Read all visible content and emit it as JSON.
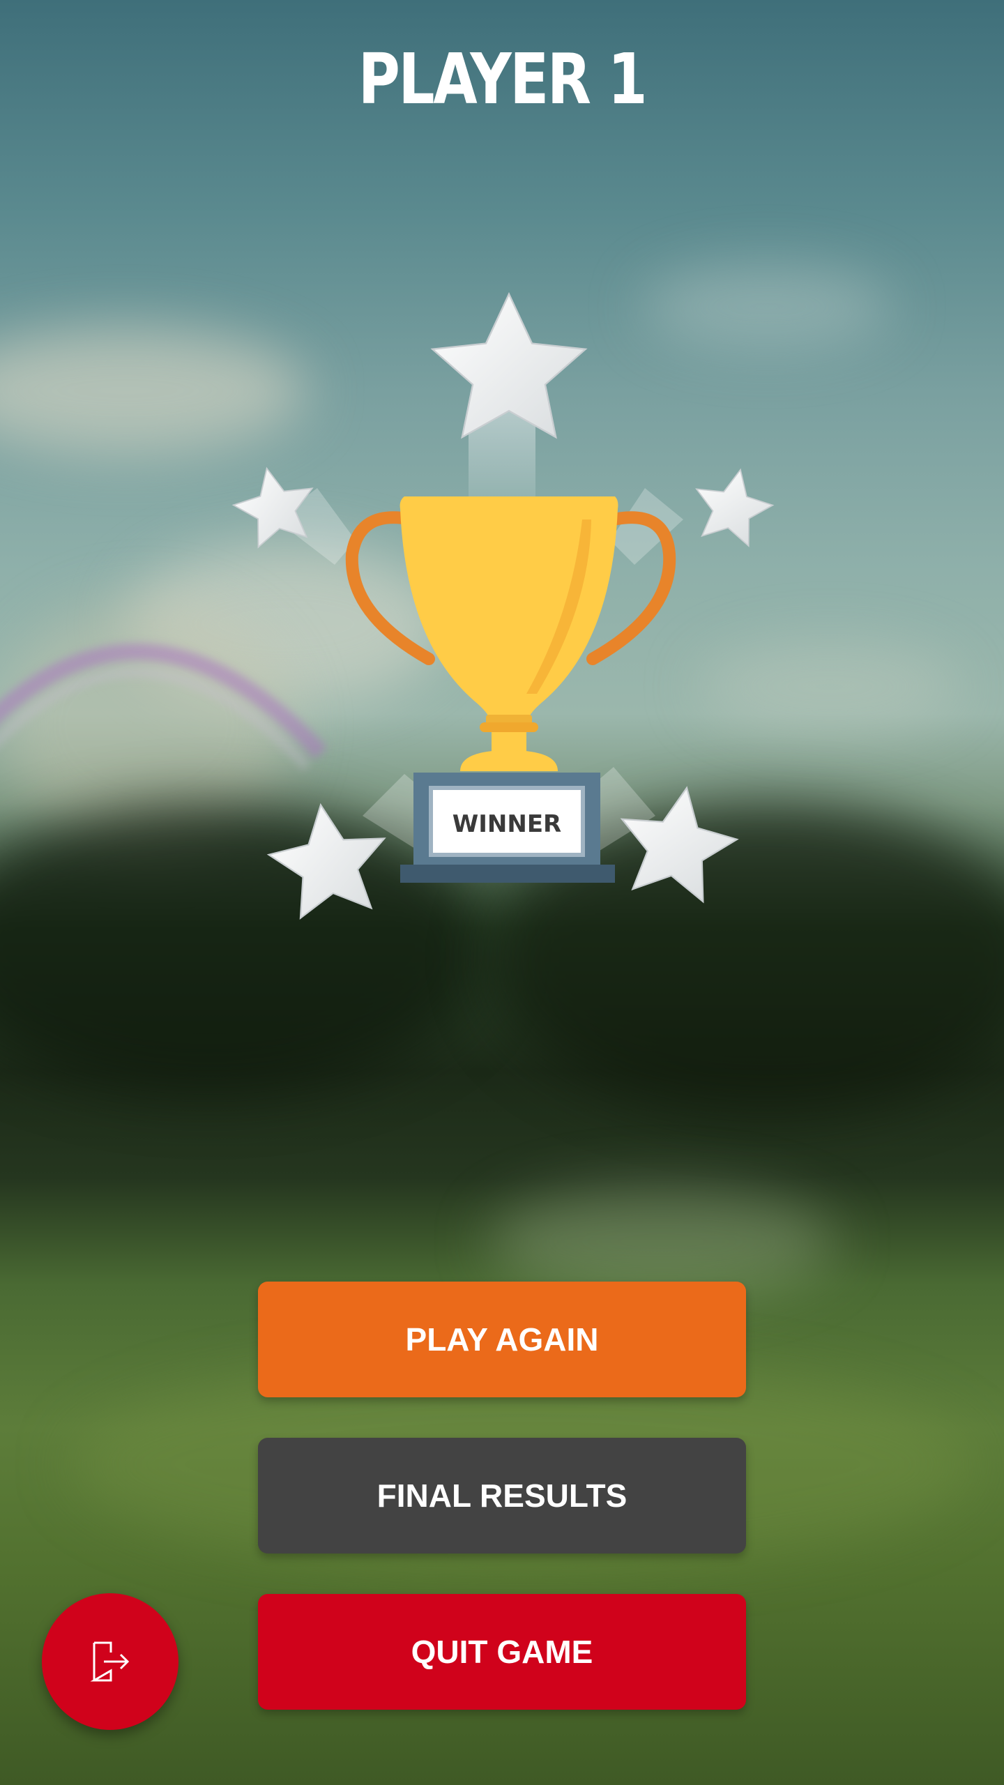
{
  "header": {
    "title": "PLAYER 1"
  },
  "trophy": {
    "plaque_text": "WINNER",
    "icon": "trophy-icon",
    "star_icon": "star-icon"
  },
  "actions": {
    "play_again_label": "PLAY AGAIN",
    "final_results_label": "FINAL RESULTS",
    "quit_game_label": "QUIT GAME"
  },
  "fab": {
    "icon": "exit-icon"
  },
  "colors": {
    "play_again": "#eb6a1a",
    "final_results": "#434343",
    "quit_game": "#d0021b",
    "trophy_gold": "#ffcc47",
    "trophy_handles": "#e8842a",
    "trophy_base": "#5a7a90"
  }
}
